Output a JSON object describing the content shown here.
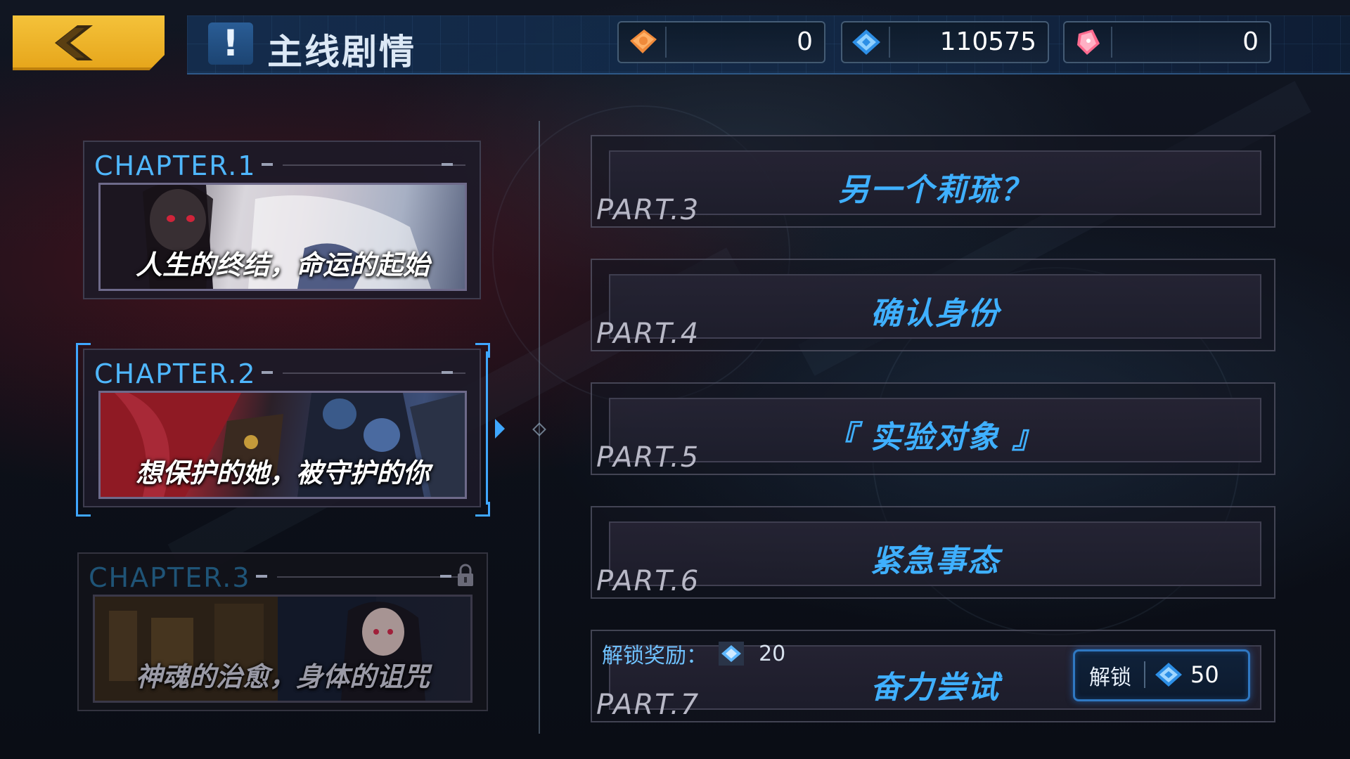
{
  "header": {
    "title": "主线剧情",
    "title_icon": "exclamation-icon",
    "back_icon": "back-chevron-icon"
  },
  "currencies": [
    {
      "icon": "orange-ticket-icon",
      "value": "0",
      "color": "#f08a3a"
    },
    {
      "icon": "blue-crystal-icon",
      "value": "110575",
      "color": "#3fa7ff"
    },
    {
      "icon": "pink-gem-icon",
      "value": "0",
      "color": "#ff6b8f"
    }
  ],
  "chapters": [
    {
      "label": "CHAPTER.1",
      "subtitle": "人生的终结，命运的起始",
      "state": "normal"
    },
    {
      "label": "CHAPTER.2",
      "subtitle": "想保护的她，被守护的你",
      "state": "selected"
    },
    {
      "label": "CHAPTER.3",
      "subtitle": "神魂的治愈，身体的诅咒",
      "state": "locked"
    }
  ],
  "parts": [
    {
      "label": "PART.3",
      "title": "另一个莉琉？"
    },
    {
      "label": "PART.4",
      "title": "确认身份"
    },
    {
      "label": "PART.5",
      "title": "『 实验对象 』"
    },
    {
      "label": "PART.6",
      "title": "紧急事态"
    },
    {
      "label": "PART.7",
      "title": "奋力尝试",
      "reward_label": "解锁奖励：",
      "reward_value": "20",
      "unlock_label": "解锁",
      "unlock_cost": "50"
    }
  ],
  "colors": {
    "accent": "#3fa7ff",
    "back_button": "#f2b630",
    "part_title": "#3fb0ff"
  }
}
